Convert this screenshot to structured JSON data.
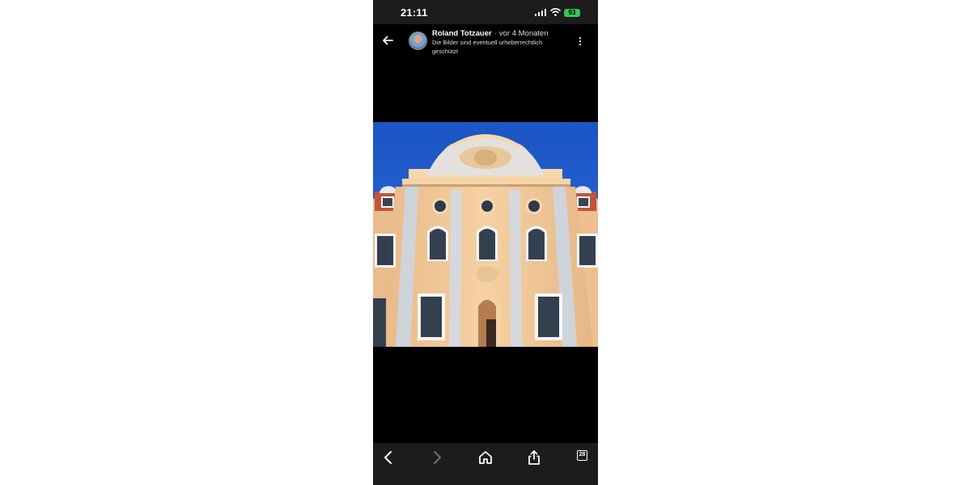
{
  "status_bar": {
    "time": "21:11",
    "battery": "93"
  },
  "post_header": {
    "author": "Roland Totzauer",
    "separator": "·",
    "posted_ago": "vor 4 Monaten",
    "copyright_notice": "Die Bilder sind eventuell urheberrechtlich geschützt"
  },
  "browser_toolbar": {
    "tab_count": "28"
  },
  "icons": {
    "back": "arrow-left-icon",
    "more": "vertical-ellipsis-icon",
    "nav_back": "chevron-left-icon",
    "nav_forward": "chevron-right-icon",
    "home": "home-icon",
    "share": "share-icon",
    "tabs": "tabs-icon"
  },
  "colors": {
    "sky": "#1f5fc9",
    "facade": "#f2c896",
    "pilaster": "#cfd3da",
    "battery": "#34c759",
    "toolbar": "#1c1c1e"
  }
}
